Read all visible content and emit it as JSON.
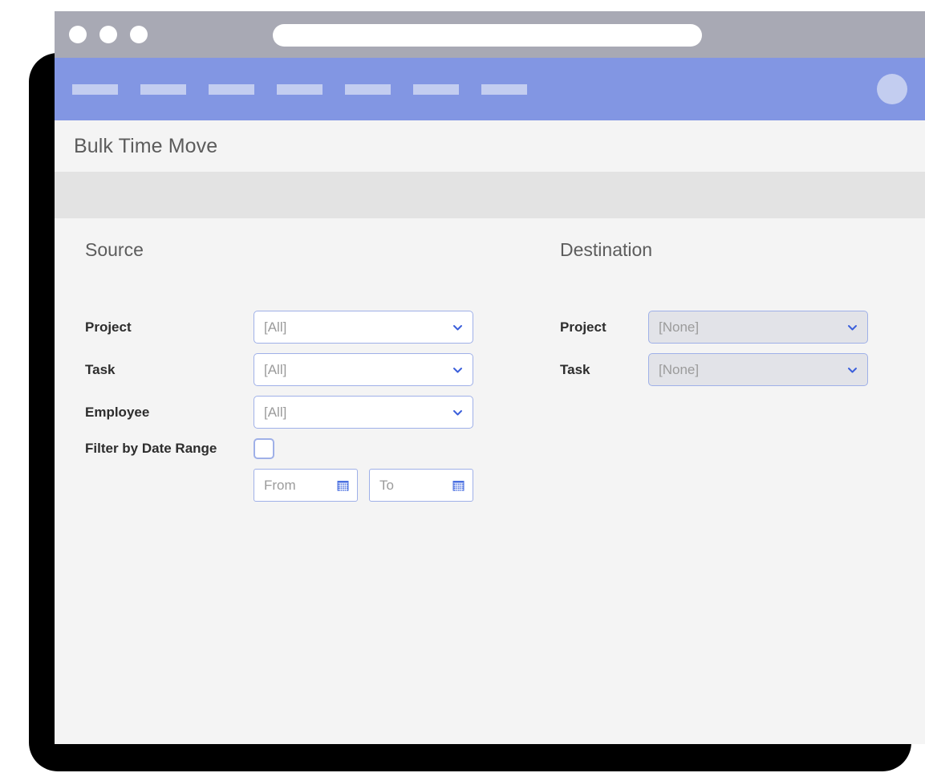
{
  "browser": {
    "traffic_lights": [
      "close",
      "minimize",
      "maximize"
    ],
    "url_value": "",
    "url_placeholder": ""
  },
  "navbar": {
    "items": [
      {
        "label": ""
      },
      {
        "label": ""
      },
      {
        "label": ""
      },
      {
        "label": ""
      },
      {
        "label": ""
      },
      {
        "label": ""
      },
      {
        "label": ""
      }
    ],
    "avatar_icon": "user-avatar-icon"
  },
  "header": {
    "title": "Bulk Time Move"
  },
  "source": {
    "heading": "Source",
    "fields": [
      {
        "label": "Project",
        "value": "[All]",
        "icon": "chevron-down-icon",
        "disabled": false
      },
      {
        "label": "Task",
        "value": "[All]",
        "icon": "chevron-down-icon",
        "disabled": false
      },
      {
        "label": "Employee",
        "value": "[All]",
        "icon": "chevron-down-icon",
        "disabled": false
      }
    ],
    "date_filter": {
      "label": "Filter by Date Range",
      "checked": false,
      "from_placeholder": "From",
      "from_value": "",
      "to_placeholder": "To",
      "to_value": "",
      "calendar_icon": "calendar-icon"
    }
  },
  "destination": {
    "heading": "Destination",
    "fields": [
      {
        "label": "Project",
        "value": "[None]",
        "icon": "chevron-down-icon",
        "disabled": true
      },
      {
        "label": "Task",
        "value": "[None]",
        "icon": "chevron-down-icon",
        "disabled": true
      }
    ]
  },
  "colors": {
    "nav_bar": "#8296e3",
    "nav_item": "#c3cdf0",
    "chrome": "#a8a9b4",
    "page_bg": "#f4f4f4",
    "toolbar": "#e3e3e3",
    "field_border": "#9fb0e8",
    "chevron": "#3b5fdb",
    "disabled_field": "#e2e3e8",
    "title_text": "#5c5c5c",
    "label_text": "#2d2d2d",
    "placeholder_text": "#9b9b9b",
    "backdrop": "#000000"
  }
}
